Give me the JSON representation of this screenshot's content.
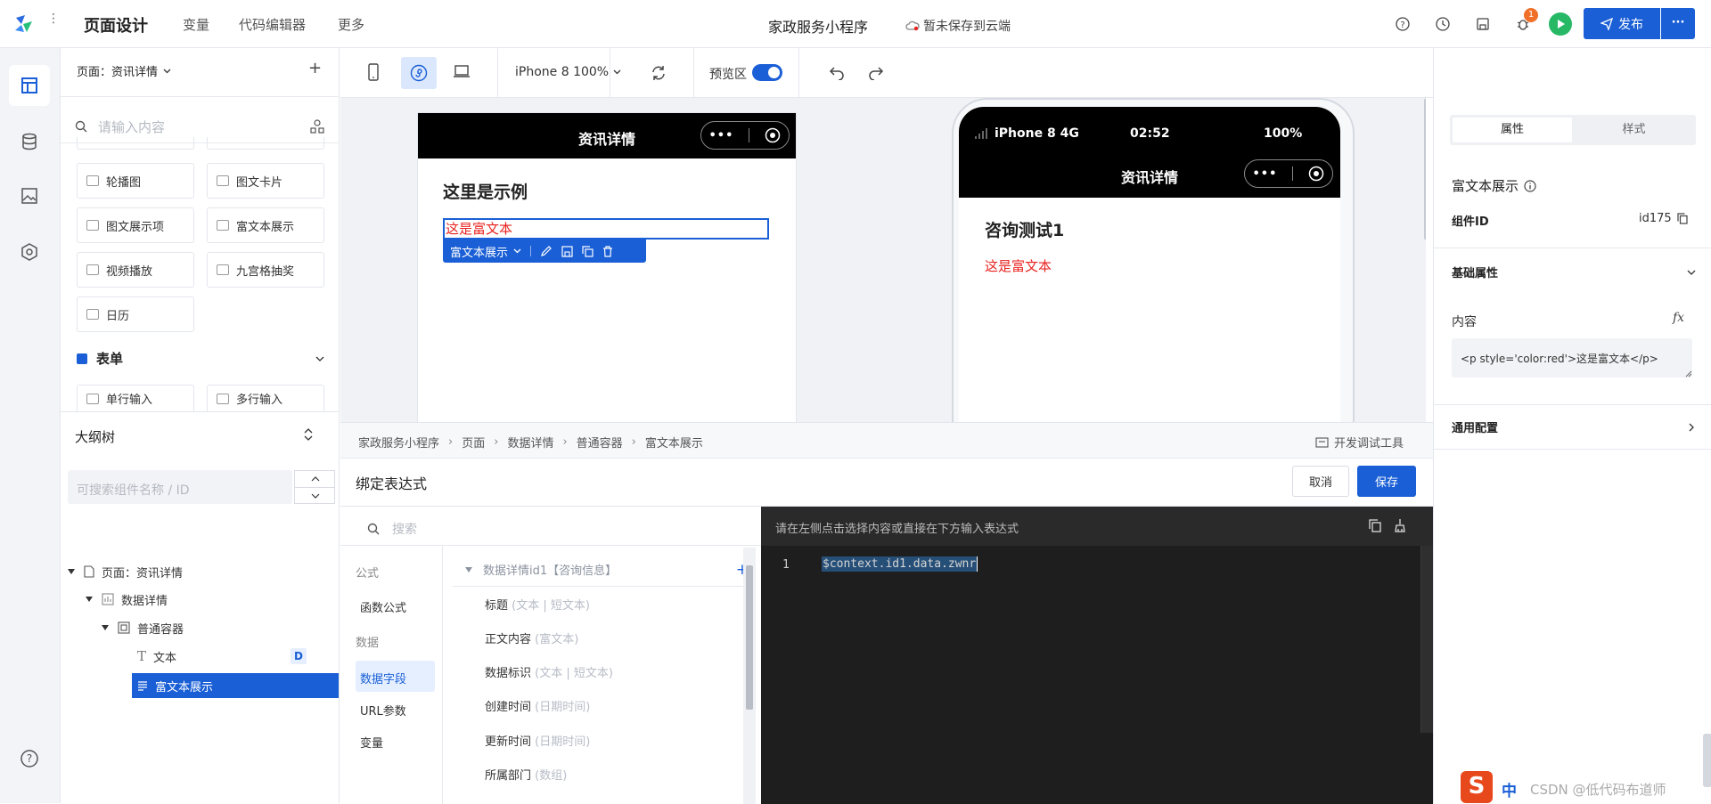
{
  "topbar": {
    "app_title": "页面设计",
    "menu": [
      "变量",
      "代码编辑器",
      "更多"
    ],
    "project_name": "家政服务小程序",
    "save_status": "暂未保存到云端",
    "notification_count": "1",
    "publish_label": "发布",
    "more_label": "···"
  },
  "left_panel": {
    "page_selector": "页面：资讯详情",
    "search_placeholder": "请输入内容",
    "components": [
      "轮播图",
      "图文卡片",
      "图文展示项",
      "富文本展示",
      "视频播放",
      "九宫格抽奖",
      "日历"
    ],
    "form_section": "表单",
    "form_components": [
      "单行输入",
      "多行输入"
    ]
  },
  "outline": {
    "title": "大纲树",
    "search_placeholder": "可搜索组件名称 / ID",
    "items": [
      "页面：资讯详情",
      "数据详情",
      "普通容器",
      "文本",
      "富文本展示"
    ],
    "text_badge": "D"
  },
  "toolbar": {
    "device": "iPhone 8 100%",
    "preview_label": "预览区"
  },
  "editor_canvas": {
    "nav_title": "资讯详情",
    "heading": "这里是示例",
    "rich_text": "这是富文本",
    "selection_label": "富文本展示"
  },
  "phone_preview": {
    "carrier": "iPhone 8  4G",
    "time": "02:52",
    "battery": "100%",
    "nav_title": "资讯详情",
    "heading": "咨询测试1",
    "rich_text": "这是富文本"
  },
  "breadcrumb": [
    "家政服务小程序",
    "页面",
    "数据详情",
    "普通容器",
    "富文本展示"
  ],
  "debug_tool": "开发调试工具",
  "binding": {
    "title": "绑定表达式",
    "cancel": "取消",
    "save": "保存",
    "search_placeholder": "搜索",
    "categories": [
      "公式",
      "函数公式",
      "数据",
      "数据字段",
      "URL参数",
      "变量"
    ],
    "datasource": "数据详情id1【咨询信息】",
    "fields": [
      {
        "name": "标题",
        "type": "(文本 | 短文本)"
      },
      {
        "name": "正文内容",
        "type": "(富文本)"
      },
      {
        "name": "数据标识",
        "type": "(文本 | 短文本)"
      },
      {
        "name": "创建时间",
        "type": "(日期时间)"
      },
      {
        "name": "更新时间",
        "type": "(日期时间)"
      },
      {
        "name": "所属部门",
        "type": "(数组)"
      }
    ],
    "hint": "请在左侧点击选择内容或直接在下方输入表达式",
    "line_number": "1",
    "expression": "$context.id1.data.zwnr"
  },
  "right_panel": {
    "tabs": [
      "属性",
      "样式"
    ],
    "component_name": "富文本展示",
    "component_id_label": "组件ID",
    "component_id": "id175",
    "basic_props": "基础属性",
    "content_label": "内容",
    "fx_label": "fx",
    "content_value": "<p style='color:red'>这是富文本</p>",
    "general_config": "通用配置"
  },
  "watermark": "CSDN @低代码布道师",
  "ime": "中",
  "colors": {
    "accent": "#1a5fd6",
    "rich_red": "#e8231f",
    "editor_bg": "#1e1e1e"
  }
}
